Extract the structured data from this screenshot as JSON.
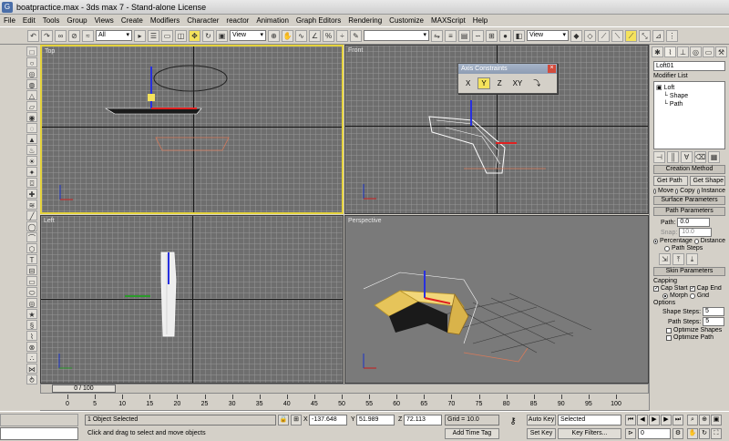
{
  "window": {
    "title": "boatpractice.max - 3ds max 7 - Stand-alone License",
    "app_icon": "G"
  },
  "menu": [
    "File",
    "Edit",
    "Tools",
    "Group",
    "Views",
    "Create",
    "Modifiers",
    "Character",
    "reactor",
    "Animation",
    "Graph Editors",
    "Rendering",
    "Customize",
    "MAXScript",
    "Help"
  ],
  "toolbar": {
    "selection_filter": "All",
    "ref_coord_1": "View",
    "named_selection": "",
    "ref_coord_2": "View"
  },
  "viewports": {
    "top": "Top",
    "front": "Front",
    "left": "Left",
    "perspective": "Perspective"
  },
  "axis_constraints": {
    "title": "Axis Constraints",
    "buttons": [
      "X",
      "Y",
      "Z",
      "XY"
    ],
    "selected": "Y"
  },
  "command_panel": {
    "object_name": "Loft01",
    "modifier_list": "Modifier List",
    "stack": [
      "Loft",
      "Shape",
      "Path"
    ],
    "creation_method": {
      "header": "Creation Method",
      "get_path": "Get Path",
      "get_shape": "Get Shape",
      "options": [
        "Move",
        "Copy",
        "Instance"
      ]
    },
    "surface_parameters": "Surface Parameters",
    "path_parameters": {
      "header": "Path Parameters",
      "path_label": "Path:",
      "path_value": "0.0",
      "snap_label": "Snap:",
      "snap_value": "10.0",
      "percentage": "Percentage",
      "distance": "Distance",
      "path_steps": "Path Steps"
    },
    "skin_parameters": {
      "header": "Skin Parameters",
      "capping": "Capping",
      "cap_start": "Cap Start",
      "cap_end": "Cap End",
      "morph": "Morph",
      "grid": "Grid",
      "options": "Options",
      "shape_steps_label": "Shape Steps:",
      "shape_steps": "5",
      "path_steps_label": "Path Steps:",
      "path_steps": "5",
      "optimize_shapes": "Optimize Shapes",
      "optimize_path": "Optimize Path"
    }
  },
  "time_slider": {
    "frame": "0 / 100",
    "ticks": [
      0,
      5,
      10,
      15,
      20,
      25,
      30,
      35,
      40,
      45,
      50,
      55,
      60,
      65,
      70,
      75,
      80,
      85,
      90,
      95,
      100
    ]
  },
  "status": {
    "selection": "1 Object Selected",
    "prompt": "Click and drag to select and move objects",
    "x_label": "X",
    "x": "-137.648",
    "y_label": "Y",
    "y": "51.989",
    "z_label": "Z",
    "z": "72.113",
    "grid": "Grid = 10.0",
    "add_time_tag": "Add Time Tag",
    "auto_key": "Auto Key",
    "set_key": "Set Key",
    "key_mode": "Selected",
    "key_filters": "Key Filters...",
    "current_frame": "0"
  }
}
